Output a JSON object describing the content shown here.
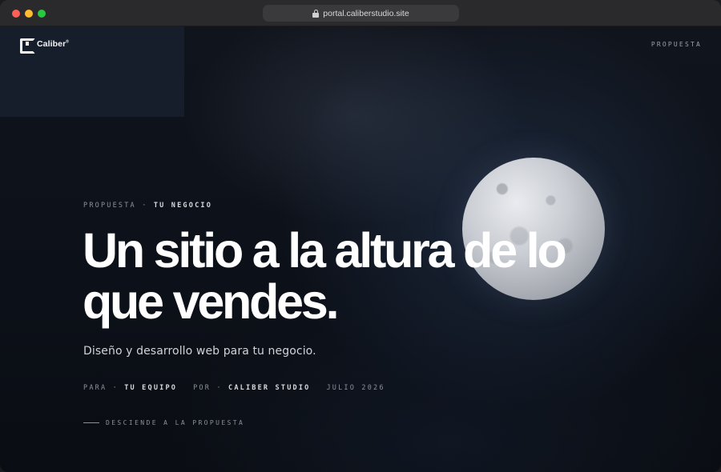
{
  "browser": {
    "url": "portal.caliberstudio.site"
  },
  "header": {
    "brand": "Caliber",
    "brand_mark": "®",
    "nav_link": "PROPUESTA"
  },
  "hero": {
    "eyebrow_prefix": "PROPUESTA",
    "eyebrow_separator": "·",
    "eyebrow_highlight": "TU NEGOCIO",
    "headline": "Un sitio a la altura de lo que vendes.",
    "subhead": "Diseño y desarrollo web para tu negocio.",
    "meta": {
      "for_label": "PARA ·",
      "for_value": "TU EQUIPO",
      "by_label": "POR ·",
      "by_value": "CALIBER STUDIO",
      "date": "JULIO 2026"
    },
    "scroll_cue": "DESCIENDE A LA PROPUESTA"
  },
  "colors": {
    "background": "#0b0d12",
    "text_primary": "#ffffff",
    "text_muted": "#8b909a"
  },
  "icons": [
    "lock-icon",
    "caliber-logo-icon",
    "moon-image"
  ]
}
